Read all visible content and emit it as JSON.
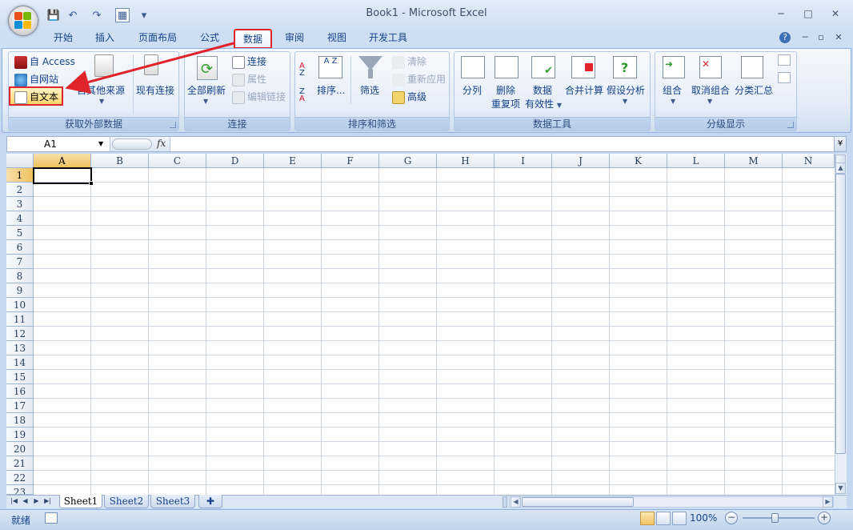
{
  "window": {
    "title": "Book1 - Microsoft Excel",
    "controls": {
      "minimize": "─",
      "maximize": "□",
      "close": "✕"
    }
  },
  "qat": {
    "save": "💾",
    "undo": "↶",
    "redo": "↷",
    "custom": "▦",
    "more": "▾"
  },
  "tabs": [
    {
      "label": "开始"
    },
    {
      "label": "插入"
    },
    {
      "label": "页面布局"
    },
    {
      "label": "公式"
    },
    {
      "label": "数据",
      "active": true
    },
    {
      "label": "审阅"
    },
    {
      "label": "视图"
    },
    {
      "label": "开发工具"
    }
  ],
  "ribbon_controls": {
    "help": "?",
    "min": "─",
    "restore": "▫",
    "close": "✕"
  },
  "groups": {
    "external": {
      "label": "获取外部数据",
      "access": "自 Access",
      "web": "自网站",
      "text": "自文本",
      "other": "自其他来源",
      "existing": "现有连接"
    },
    "connections": {
      "label": "连接",
      "refresh": "全部刷新",
      "connections": "连接",
      "properties": "属性",
      "edit_links": "编辑链接"
    },
    "sort": {
      "label": "排序和筛选",
      "sort": "排序...",
      "filter": "筛选",
      "clear": "清除",
      "reapply": "重新应用",
      "advanced": "高级",
      "az": "A Z",
      "za": "Z A"
    },
    "tools": {
      "label": "数据工具",
      "split": "分列",
      "remove_dup_1": "删除",
      "remove_dup_2": "重复项",
      "validation_1": "数据",
      "validation_2": "有效性",
      "consolidate": "合并计算",
      "whatif": "假设分析"
    },
    "outline": {
      "label": "分级显示",
      "group": "组合",
      "ungroup": "取消组合",
      "subtotal": "分类汇总"
    }
  },
  "formula_bar": {
    "name_box": "A1",
    "fx": "fx",
    "value": ""
  },
  "grid": {
    "columns": [
      "A",
      "B",
      "C",
      "D",
      "E",
      "F",
      "G",
      "H",
      "I",
      "J",
      "K",
      "L",
      "M",
      "N"
    ],
    "rows": [
      "1",
      "2",
      "3",
      "4",
      "5",
      "6",
      "7",
      "8",
      "9",
      "10",
      "11",
      "12",
      "13",
      "14",
      "15",
      "16",
      "17",
      "18",
      "19",
      "20",
      "21",
      "22",
      "23"
    ],
    "selected_cell": "A1"
  },
  "sheets": [
    {
      "label": "Sheet1",
      "active": true
    },
    {
      "label": "Sheet2"
    },
    {
      "label": "Sheet3"
    }
  ],
  "status": {
    "ready": "就绪",
    "zoom": "100%"
  },
  "colors": {
    "accent_red": "#e0242c",
    "ribbon_blue": "#15428b"
  }
}
